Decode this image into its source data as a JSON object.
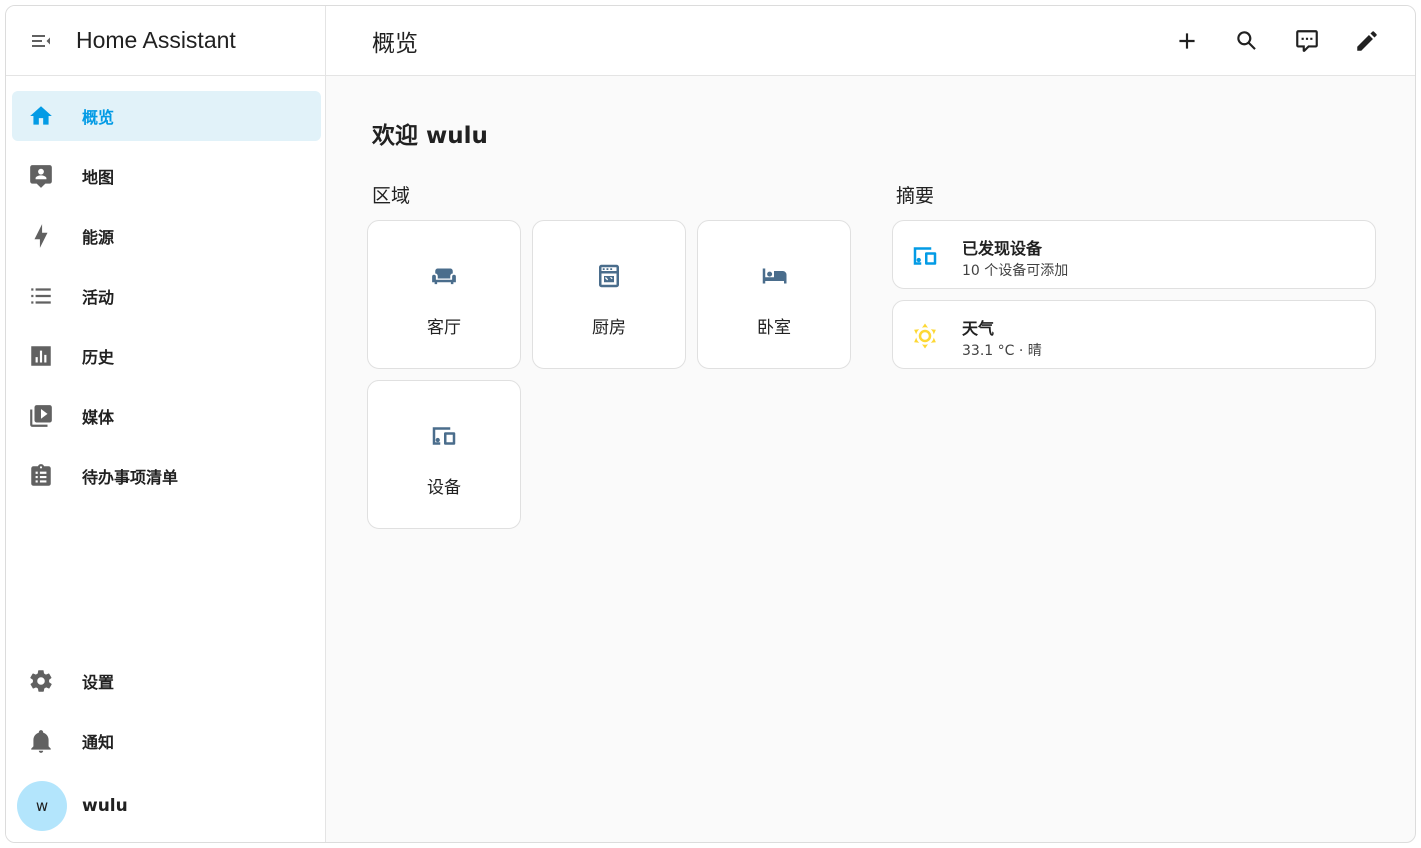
{
  "app": {
    "title": "Home Assistant"
  },
  "sidebar": {
    "items": [
      {
        "label": "概览",
        "icon": "home-icon",
        "active": true
      },
      {
        "label": "地图",
        "icon": "map-person-icon"
      },
      {
        "label": "能源",
        "icon": "lightning-icon"
      },
      {
        "label": "活动",
        "icon": "list-icon"
      },
      {
        "label": "历史",
        "icon": "chart-icon"
      },
      {
        "label": "媒体",
        "icon": "media-library-icon"
      },
      {
        "label": "待办事项清单",
        "icon": "clipboard-list-icon"
      }
    ],
    "bottom_items": [
      {
        "label": "设置",
        "icon": "gear-icon"
      },
      {
        "label": "通知",
        "icon": "bell-icon"
      }
    ],
    "user": {
      "initial": "w",
      "name": "wulu"
    }
  },
  "topbar": {
    "title": "概览",
    "actions": [
      "plus-icon",
      "search-icon",
      "chat-icon",
      "pencil-icon"
    ]
  },
  "main": {
    "welcome": "欢迎 wulu",
    "areas_title": "区域",
    "summary_title": "摘要",
    "areas": [
      {
        "label": "客厅",
        "icon": "sofa-icon"
      },
      {
        "label": "厨房",
        "icon": "stove-icon"
      },
      {
        "label": "卧室",
        "icon": "bed-icon"
      },
      {
        "label": "设备",
        "icon": "devices-icon"
      }
    ],
    "summary": [
      {
        "title": "已发现设备",
        "subtitle": "10 个设备可添加",
        "icon": "devices-icon"
      },
      {
        "title": "天气",
        "subtitle": "33.1 °C · 晴",
        "icon": "sun-icon"
      }
    ]
  },
  "colors": {
    "accent": "#039be5",
    "active_bg": "#e1f2f9",
    "icon_gray": "#616161",
    "area_icon": "#4a6d8c",
    "sun": "#fdd835",
    "avatar_bg": "#b3e5fc"
  }
}
